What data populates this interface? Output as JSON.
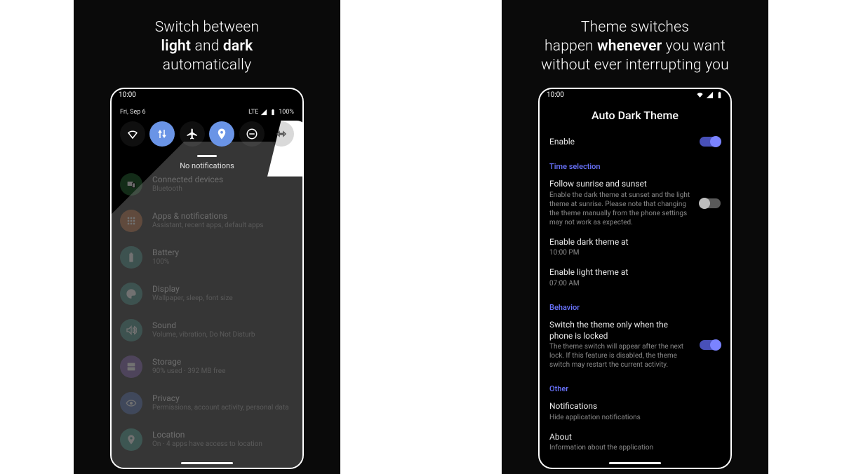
{
  "promo1": {
    "line1": "Switch between",
    "line2_a": "light",
    "line2_mid": " and ",
    "line2_b": "dark",
    "line3": "automatically"
  },
  "promo2": {
    "line1": "Theme switches",
    "line2_a": "happen ",
    "line2_b": "whenever",
    "line2_c": " you want",
    "line3": "without ever interrupting you"
  },
  "status": {
    "time": "10:00"
  },
  "qs": {
    "date": "Fri, Sep 6",
    "net_label": "LTE",
    "battery_pct": "100%",
    "no_notifications": "No notifications"
  },
  "settings_items": [
    {
      "icon": "devices",
      "color": "#2e6a3a",
      "title": "Connected devices",
      "sub": "Bluetooth"
    },
    {
      "icon": "apps",
      "color": "#b55a1f",
      "title": "Apps & notifications",
      "sub": "Assistant, recent apps, default apps"
    },
    {
      "icon": "battery",
      "color": "#1f7a6f",
      "title": "Battery",
      "sub": "100%"
    },
    {
      "icon": "display",
      "color": "#1f7a6f",
      "title": "Display",
      "sub": "Wallpaper, sleep, font size"
    },
    {
      "icon": "sound",
      "color": "#1f7a6f",
      "title": "Sound",
      "sub": "Volume, vibration, Do Not Disturb"
    },
    {
      "icon": "storage",
      "color": "#6a3fa0",
      "title": "Storage",
      "sub": "90% used · 392 MB free"
    },
    {
      "icon": "privacy",
      "color": "#2a4fa0",
      "title": "Privacy",
      "sub": "Permissions, account activity, personal data"
    },
    {
      "icon": "location",
      "color": "#1f8a7a",
      "title": "Location",
      "sub": "On · 4 apps have access to location"
    }
  ],
  "app": {
    "title": "Auto Dark Theme",
    "enable_label": "Enable",
    "cat_time": "Time selection",
    "follow_title": "Follow sunrise and sunset",
    "follow_sub": "Enable the dark theme at sunset and the light theme at sunrise. Please note that changing the theme manually from the phone settings may not work as expected.",
    "dark_at_title": "Enable dark theme at",
    "dark_at_value": "10:00 PM",
    "light_at_title": "Enable light theme at",
    "light_at_value": "07:00 AM",
    "cat_behavior": "Behavior",
    "locked_title": "Switch the theme only when the phone is locked",
    "locked_sub": "The theme switch will appear after the next lock. If this feature is disabled, the theme switch may restart the current activity.",
    "cat_other": "Other",
    "notif_title": "Notifications",
    "notif_sub": "Hide application notifications",
    "about_title": "About",
    "about_sub": "Information about the application"
  }
}
